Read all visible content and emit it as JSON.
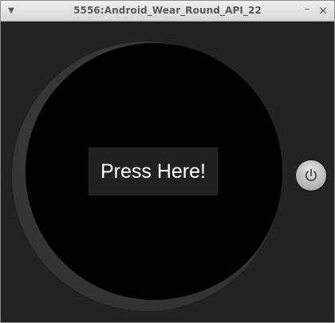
{
  "window": {
    "title": "5556:Android_Wear_Round_API_22",
    "menu_icon": "triangle-down-icon",
    "minimize_icon": "minimize-icon",
    "close_icon": "close-icon"
  },
  "app": {
    "button_label": "Press Here!"
  },
  "device": {
    "power_icon": "power-icon"
  },
  "colors": {
    "background": "#232323",
    "bezel": "#3a3a3a",
    "screen": "#000000",
    "button_bg": "#212121",
    "button_text": "#ffffff"
  }
}
